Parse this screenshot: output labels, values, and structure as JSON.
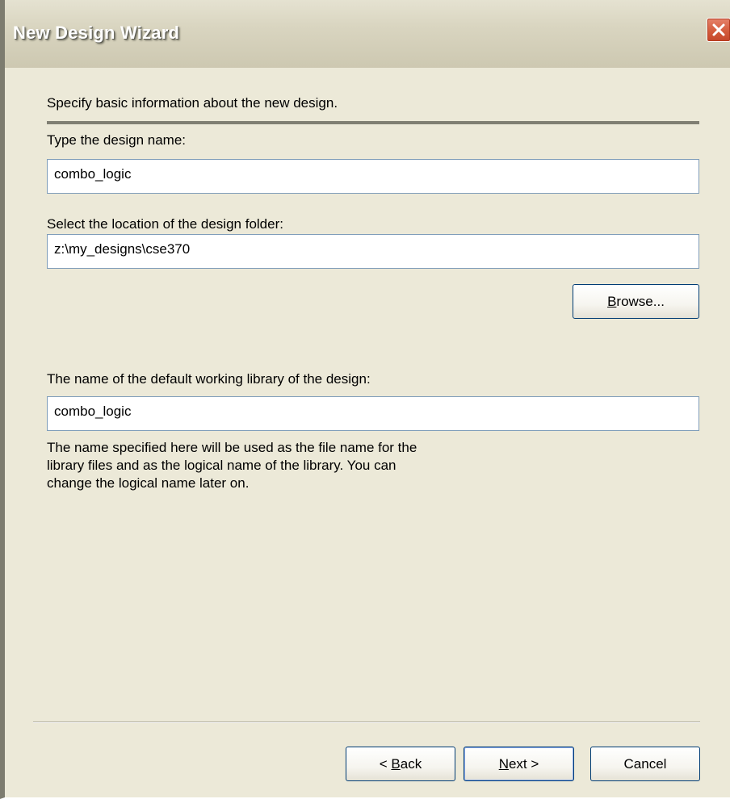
{
  "window": {
    "title": "New Design Wizard",
    "close_icon": "close-icon"
  },
  "intro": "Specify basic information about the new design.",
  "design_name": {
    "label": "Type the design name:",
    "value": "combo_logic"
  },
  "location": {
    "label": "Select the location of the design folder:",
    "value": "z:\\my_designs\\cse370",
    "browse_prefix": "",
    "browse_mnemonic": "B",
    "browse_rest": "rowse..."
  },
  "library": {
    "label": "The name of the default working library of the design:",
    "value": "combo_logic",
    "description_lines": [
      "The name specified here will be used as the file name for the",
      "library files and as the logical name of the library. You can",
      "change the logical name later on."
    ]
  },
  "buttons": {
    "back_prefix": "< ",
    "back_mnemonic": "B",
    "back_rest": "ack",
    "next_prefix": "",
    "next_mnemonic": "N",
    "next_rest": "ext >",
    "cancel": "Cancel"
  },
  "colors": {
    "dialog_bg": "#ece9d8",
    "close_red": "#d45c3c",
    "textbox_border": "#7f9db9",
    "button_border": "#003c74"
  }
}
